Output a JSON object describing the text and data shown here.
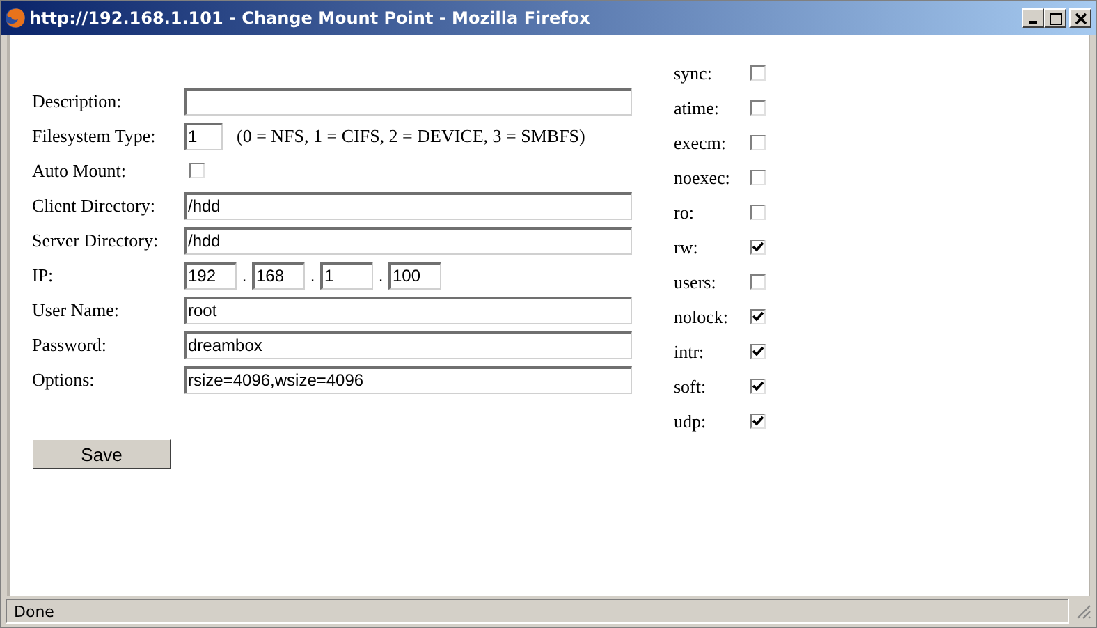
{
  "window": {
    "title": "http://192.168.1.101 - Change Mount Point - Mozilla Firefox"
  },
  "fields": [
    {
      "kind": "text",
      "label": "Description:"
    },
    {
      "kind": "short",
      "label": "Filesystem Type:",
      "value": "1",
      "hint": "(0 = NFS, 1 = CIFS, 2 = DEVICE, 3 = SMBFS)"
    },
    {
      "kind": "checkbox",
      "label": "Auto Mount:",
      "checked": false
    },
    {
      "kind": "text",
      "label": "Client Directory:",
      "value": "/hdd"
    },
    {
      "kind": "text",
      "label": "Server Directory:",
      "value": "/hdd"
    },
    {
      "kind": "ip",
      "label": "IP:",
      "octets": [
        "192",
        "168",
        "1",
        "100"
      ],
      "separators": [
        ".",
        ".",
        "."
      ]
    },
    {
      "kind": "text",
      "label": "User Name:",
      "value": "root"
    },
    {
      "kind": "text",
      "label": "Password:",
      "value": "dreambox"
    },
    {
      "kind": "text",
      "label": "Options:",
      "value": "rsize=4096,wsize=4096"
    }
  ],
  "save_button": "Save",
  "options": [
    {
      "label": "sync:",
      "checked": false
    },
    {
      "label": "atime:",
      "checked": false
    },
    {
      "label": "execm:",
      "checked": false
    },
    {
      "label": "noexec:",
      "checked": false
    },
    {
      "label": "ro:",
      "checked": false
    },
    {
      "label": "rw:",
      "checked": true
    },
    {
      "label": "users:",
      "checked": false
    },
    {
      "label": "nolock:",
      "checked": true
    },
    {
      "label": "intr:",
      "checked": true
    },
    {
      "label": "soft:",
      "checked": true
    },
    {
      "label": "udp:",
      "checked": true
    }
  ],
  "status_bar": "Done"
}
